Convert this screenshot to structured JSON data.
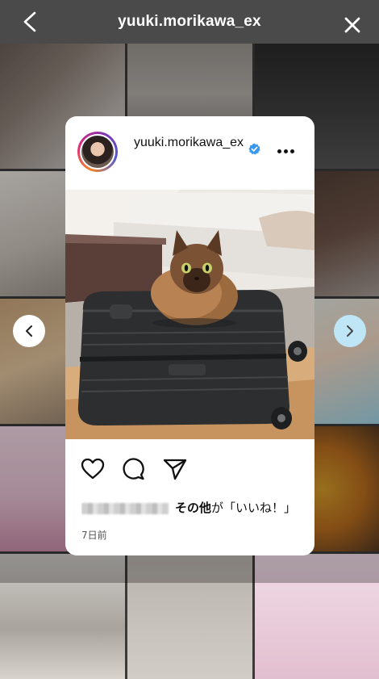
{
  "header": {
    "title": "yuuki.morikawa_ex",
    "back_icon": "chevron-left-icon",
    "close_icon": "close-icon"
  },
  "post": {
    "username": "yuuki.morikawa_ex",
    "verified_icon": "verified-badge-icon",
    "more_icon": "more-horizontal-icon",
    "photo_alt_icon": "photo-cat-on-suitcase",
    "actions": {
      "like_icon": "heart-icon",
      "comment_icon": "comment-icon",
      "share_icon": "send-icon"
    },
    "likes": {
      "others_label": "その他",
      "suffix": "が「いいね！」"
    },
    "timestamp": "7日前"
  },
  "navigation": {
    "prev_icon": "chevron-left-icon",
    "next_icon": "chevron-right-icon"
  },
  "colors": {
    "topbar": "#4a4a4a",
    "verified": "#3897f0",
    "next_button": "#bfe6f6"
  }
}
